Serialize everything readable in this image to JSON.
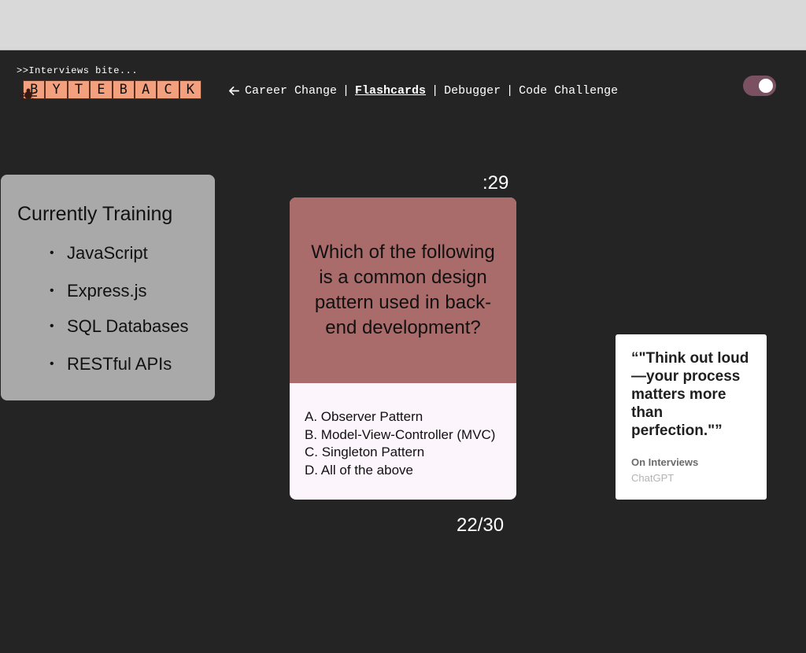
{
  "header": {
    "tagline": ">>Interviews bite...",
    "logo_letters": [
      "B",
      "Y",
      "T",
      "E",
      "B",
      "A",
      "C",
      "K"
    ],
    "logo_colors": {
      "cell": "#f2a07e",
      "border": "#5a2e1f",
      "bug": "#3a1a10"
    },
    "nav": {
      "back_icon": "arrow-left-icon",
      "items": [
        "Career Change",
        "Flashcards",
        "Debugger",
        "Code Challenge"
      ],
      "active": "Flashcards",
      "separator": "|"
    },
    "toggle": {
      "state": "on",
      "track_color": "#7a5160"
    }
  },
  "training": {
    "title": "Currently Training",
    "items": [
      "JavaScript",
      "Express.js",
      "SQL Databases",
      "RESTful APIs"
    ]
  },
  "flashcard": {
    "timer": ":29",
    "question": "Which of the following is a common design pattern used in back-end development?",
    "answers": [
      "A. Observer Pattern",
      "B. Model-View-Controller (MVC)",
      "C. Singleton Pattern",
      "D. All of the above"
    ],
    "progress": "22/30",
    "colors": {
      "question_bg": "#aa6b6b",
      "answers_bg": "#fcf5fc"
    }
  },
  "quote": {
    "text": "“\"Think out loud—your process matters more than perfection.\"”",
    "topic": "On Interviews",
    "author": "ChatGPT"
  }
}
